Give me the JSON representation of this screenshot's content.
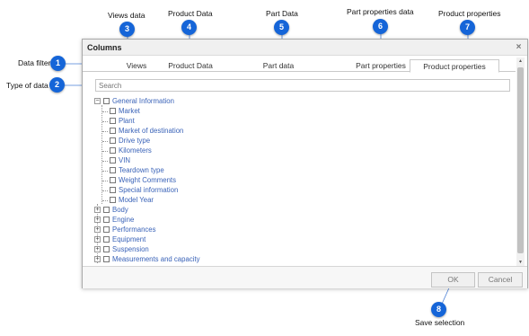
{
  "callouts": [
    {
      "num": "1",
      "label": "Data filter"
    },
    {
      "num": "2",
      "label": "Type of data"
    },
    {
      "num": "3",
      "label": "Views data"
    },
    {
      "num": "4",
      "label": "Product Data"
    },
    {
      "num": "5",
      "label": "Part Data"
    },
    {
      "num": "6",
      "label": "Part properties data"
    },
    {
      "num": "7",
      "label": "Product properties"
    },
    {
      "num": "8",
      "label": "Save selection"
    }
  ],
  "dialog": {
    "title": "Columns",
    "close_icon": "×",
    "tabs": [
      "Views",
      "Product Data",
      "Part data",
      "Part properties",
      "Product properties"
    ],
    "active_tab": "Product properties",
    "search_placeholder": "Search",
    "tree": {
      "general": "General Information",
      "children": [
        "Market",
        "Plant",
        "Market of destination",
        "Drive type",
        "Kilometers",
        "VIN",
        "Teardown type",
        "Weight Comments",
        "Special information",
        "Model Year"
      ],
      "groups": [
        "Body",
        "Engine",
        "Performances",
        "Equipment",
        "Suspension",
        "Measurements and capacity"
      ]
    },
    "ok_label": "OK",
    "cancel_label": "Cancel"
  },
  "colors": {
    "badge": "#1565d8",
    "link_text": "#3a63b8"
  }
}
